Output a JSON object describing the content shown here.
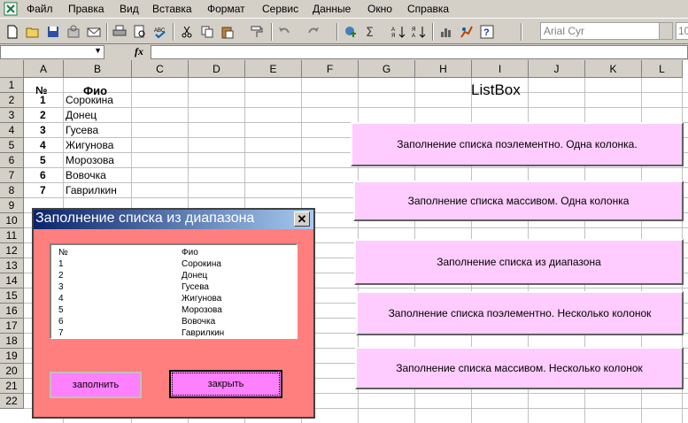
{
  "menubar": {
    "items": [
      "Файл",
      "Правка",
      "Вид",
      "Вставка",
      "Формат",
      "Сервис",
      "Данные",
      "Окно",
      "Справка"
    ]
  },
  "toolbar": {
    "icons": [
      "new-icon",
      "open-icon",
      "save-icon",
      "permission-icon",
      "email-icon",
      "print-icon",
      "print-preview-icon",
      "spelling-icon",
      "cut-icon",
      "copy-icon",
      "paste-icon",
      "format-painter-icon",
      "undo-icon",
      "redo-icon",
      "hyperlink-icon",
      "autosum-icon",
      "sort-asc-icon",
      "sort-desc-icon",
      "chart-icon",
      "drawing-icon",
      "help-icon"
    ],
    "font_name": "Arial Cyr",
    "font_size": "10"
  },
  "formula_bar": {
    "name_box": "",
    "fx_label": "fx",
    "formula": ""
  },
  "columns": [
    "A",
    "B",
    "C",
    "D",
    "E",
    "F",
    "G",
    "H",
    "I",
    "J",
    "K",
    "L"
  ],
  "rows": [
    "1",
    "2",
    "3",
    "4",
    "5",
    "6",
    "7",
    "8",
    "9",
    "10",
    "11",
    "12",
    "13",
    "14",
    "15",
    "16",
    "17",
    "18",
    "19",
    "20",
    "21",
    "22"
  ],
  "sheet": {
    "header_num": "№",
    "header_name": "Фио",
    "data": [
      {
        "num": "1",
        "name": "Сорокина"
      },
      {
        "num": "2",
        "name": "Донец"
      },
      {
        "num": "3",
        "name": "Гусева"
      },
      {
        "num": "4",
        "name": "Жигунова"
      },
      {
        "num": "5",
        "name": "Морозова"
      },
      {
        "num": "6",
        "name": "Вовочка"
      },
      {
        "num": "7",
        "name": "Гаврилкин"
      }
    ],
    "listbox_title": "ListBox",
    "buttons": [
      "Заполнение списка поэлементно. Одна колонка.",
      "Заполнение списка массивом. Одна колонка",
      "Заполнение списка из диапазона",
      "Заполнение списка поэлементно. Несколько колонок",
      "Заполнение списка массивом. Несколько колонок"
    ]
  },
  "dialog": {
    "title": "Заполнение списка из диапазона",
    "close_glyph": "✕",
    "list": [
      {
        "c1": "№",
        "c2": "Фио"
      },
      {
        "c1": "1",
        "c2": "Сорокина"
      },
      {
        "c1": "2",
        "c2": "Донец"
      },
      {
        "c1": "3",
        "c2": "Гусева"
      },
      {
        "c1": "4",
        "c2": "Жигунова"
      },
      {
        "c1": "5",
        "c2": "Морозова"
      },
      {
        "c1": "6",
        "c2": "Вовочка"
      },
      {
        "c1": "7",
        "c2": "Гаврилкин"
      }
    ],
    "fill_button": "заполнить",
    "close_button": "закрыть"
  },
  "colors": {
    "dialog_bg": "#ff7f7f",
    "sheet_button_bg": "#ffccff",
    "dialog_button_bg": "#ff80ff",
    "titlebar_start": "#0a246a",
    "titlebar_end": "#a6caf0"
  }
}
